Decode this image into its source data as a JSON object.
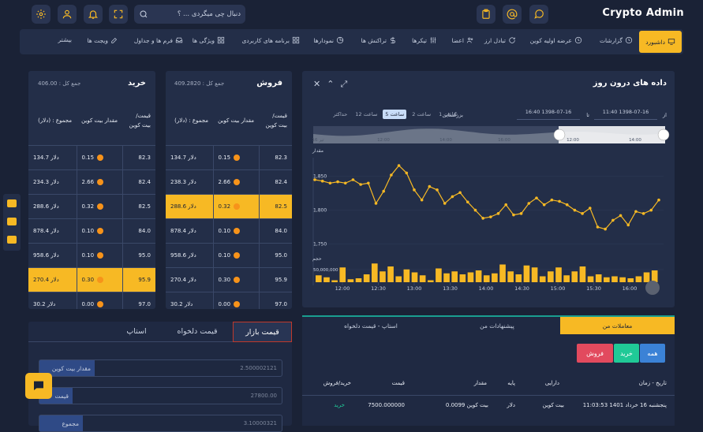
{
  "brand": "Crypto Admin",
  "search": {
    "placeholder": "دنبال چی میگردی ... ؟"
  },
  "nav": [
    {
      "label": "داشبورد",
      "icon": "monitor-icon"
    },
    {
      "label": "گزارشات",
      "icon": "clock-icon"
    },
    {
      "label": "عرضه اولیه کوین",
      "icon": "clock-icon"
    },
    {
      "label": "تبادل ارز",
      "icon": "refresh-icon"
    },
    {
      "label": "اعضا",
      "icon": "users-icon"
    },
    {
      "label": "تیکرها",
      "icon": "sliders-icon"
    },
    {
      "label": "تراکنش ها",
      "icon": "dollar-icon"
    },
    {
      "label": "نمودارها",
      "icon": "chart-icon"
    },
    {
      "label": "برنامه های کاربردی",
      "icon": "grid-icon"
    },
    {
      "label": "ویژگی ها",
      "icon": "grid-icon"
    },
    {
      "label": "فرم ها و جداول",
      "icon": "inbox-icon"
    },
    {
      "label": "ویجت ها",
      "icon": "edit-icon"
    },
    {
      "label": "بیشتر",
      "icon": ""
    }
  ],
  "buy": {
    "title": "خرید",
    "total": "جمع کل : 406.00",
    "headers": [
      "قیمت/ بیت کوین",
      "مقدار بیت کوین",
      "مجموع : (دلار)"
    ],
    "rows": [
      [
        "82.3",
        "0.15",
        "134.7 دلار"
      ],
      [
        "82.4",
        "2.66",
        "234.3 دلار"
      ],
      [
        "82.5",
        "0.32",
        "288.6 دلار"
      ],
      [
        "84.0",
        "0.10",
        "878.4 دلار"
      ],
      [
        "95.0",
        "0.10",
        "958.6 دلار"
      ],
      [
        "95.9",
        "0.30",
        "270.4 دلار"
      ],
      [
        "97.0",
        "0.00",
        "30.2 دلار"
      ]
    ],
    "highlight": 5
  },
  "sell": {
    "title": "فروش",
    "total": "جمع کل : 409.2820",
    "headers": [
      "قیمت/ بیت کوین",
      "مقدار بیت کوین",
      "مجموع : (دلار)"
    ],
    "rows": [
      [
        "82.3",
        "0.15",
        "134.7 دلار"
      ],
      [
        "82.4",
        "2.66",
        "238.3 دلار"
      ],
      [
        "82.5",
        "0.32",
        "288.6 دلار"
      ],
      [
        "84.0",
        "0.10",
        "878.4 دلار"
      ],
      [
        "95.0",
        "0.10",
        "958.6 دلار"
      ],
      [
        "95.9",
        "0.30",
        "270.4 دلار"
      ],
      [
        "97.0",
        "0.00",
        "30.2 دلار"
      ]
    ],
    "highlight": 2
  },
  "orderTabs": [
    "قیمت بازار",
    "قیمت دلخواه",
    "استاپ"
  ],
  "orderForm": [
    {
      "label": "مقدار بیت کوین",
      "value": "2.500002121"
    },
    {
      "label": "قیمت",
      "value": "27800.00"
    },
    {
      "label": "مجموع",
      "value": "3.10000321"
    }
  ],
  "intraday": {
    "title": "داده های درون روز",
    "from_label": "از",
    "from": "11:40 1398-07-16",
    "to_label": "تا",
    "to": "16:40 1398-07-16",
    "zoom_label": "بزرگنمایی",
    "zooms": [
      "1 ساعت",
      "2 ساعت",
      "5 ساعت",
      "12 ساعت",
      "حداکثر"
    ],
    "zoom_active": 2,
    "navigator_ticks": [
      "تیر 16",
      "12:00",
      "14:00",
      "16:00",
      "12:00",
      "14:00"
    ],
    "price_label": "مقدار",
    "volume_label": "حجم"
  },
  "chart_data": {
    "type": "line",
    "x_ticks": [
      "12:00",
      "12:30",
      "13:00",
      "13:30",
      "14:00",
      "14:30",
      "15:00",
      "15:30",
      "16:00"
    ],
    "y_ticks": [
      1850,
      1800,
      1750
    ],
    "ylim": [
      1740,
      1880
    ],
    "series": [
      {
        "values": [
          1845,
          1843,
          1840,
          1842,
          1840,
          1845,
          1838,
          1840,
          1810,
          1828,
          1852,
          1866,
          1855,
          1830,
          1815,
          1835,
          1830,
          1810,
          1820,
          1826,
          1812,
          1800,
          1788,
          1790,
          1795,
          1808,
          1793,
          1795,
          1810,
          1818,
          1808,
          1815,
          1813,
          1808,
          1800,
          1795,
          1803,
          1775,
          1772,
          1785,
          1792,
          1778,
          1798,
          1795,
          1800,
          1815
        ]
      }
    ],
    "volume": {
      "y_tick": "50,000,000",
      "values": [
        0.35,
        0.25,
        0.1,
        0.75,
        0.15,
        0.2,
        0.4,
        0.95,
        0.55,
        0.8,
        0.3,
        0.65,
        0.5,
        0.35,
        0.1,
        0.7,
        0.45,
        0.55,
        0.4,
        0.5,
        0.6,
        0.35,
        0.45,
        0.9,
        0.55,
        0.4,
        0.85,
        0.75,
        0.3,
        0.55,
        0.75,
        0.35,
        0.55,
        0.8,
        0.3,
        0.4,
        0.25,
        0.3,
        0.25,
        0.2,
        0.3,
        0.5,
        0.6
      ]
    }
  },
  "trades": {
    "tabs": [
      "معاملات من",
      "پیشنهادات من",
      "استاپ - قیمت دلخواه"
    ],
    "filters": [
      "همه",
      "خرید",
      "فروش"
    ],
    "headers": [
      "تاریخ - زمان",
      "دارایی",
      "پایه",
      "مقدار",
      "قیمت",
      "خرید/فروش"
    ],
    "row": [
      "پنجشنبه 16 خرداد 1401 11:03:53",
      "بیت کوین",
      "دلار",
      "0.0099 بیت کوین",
      "7500.000000",
      "خرید"
    ]
  },
  "colors": {
    "accent": "#f7b924",
    "bg": "#1a2236",
    "panel": "#232e48",
    "buy": "#20c997",
    "sell": "#e24a5e",
    "all": "#3b82d6"
  }
}
